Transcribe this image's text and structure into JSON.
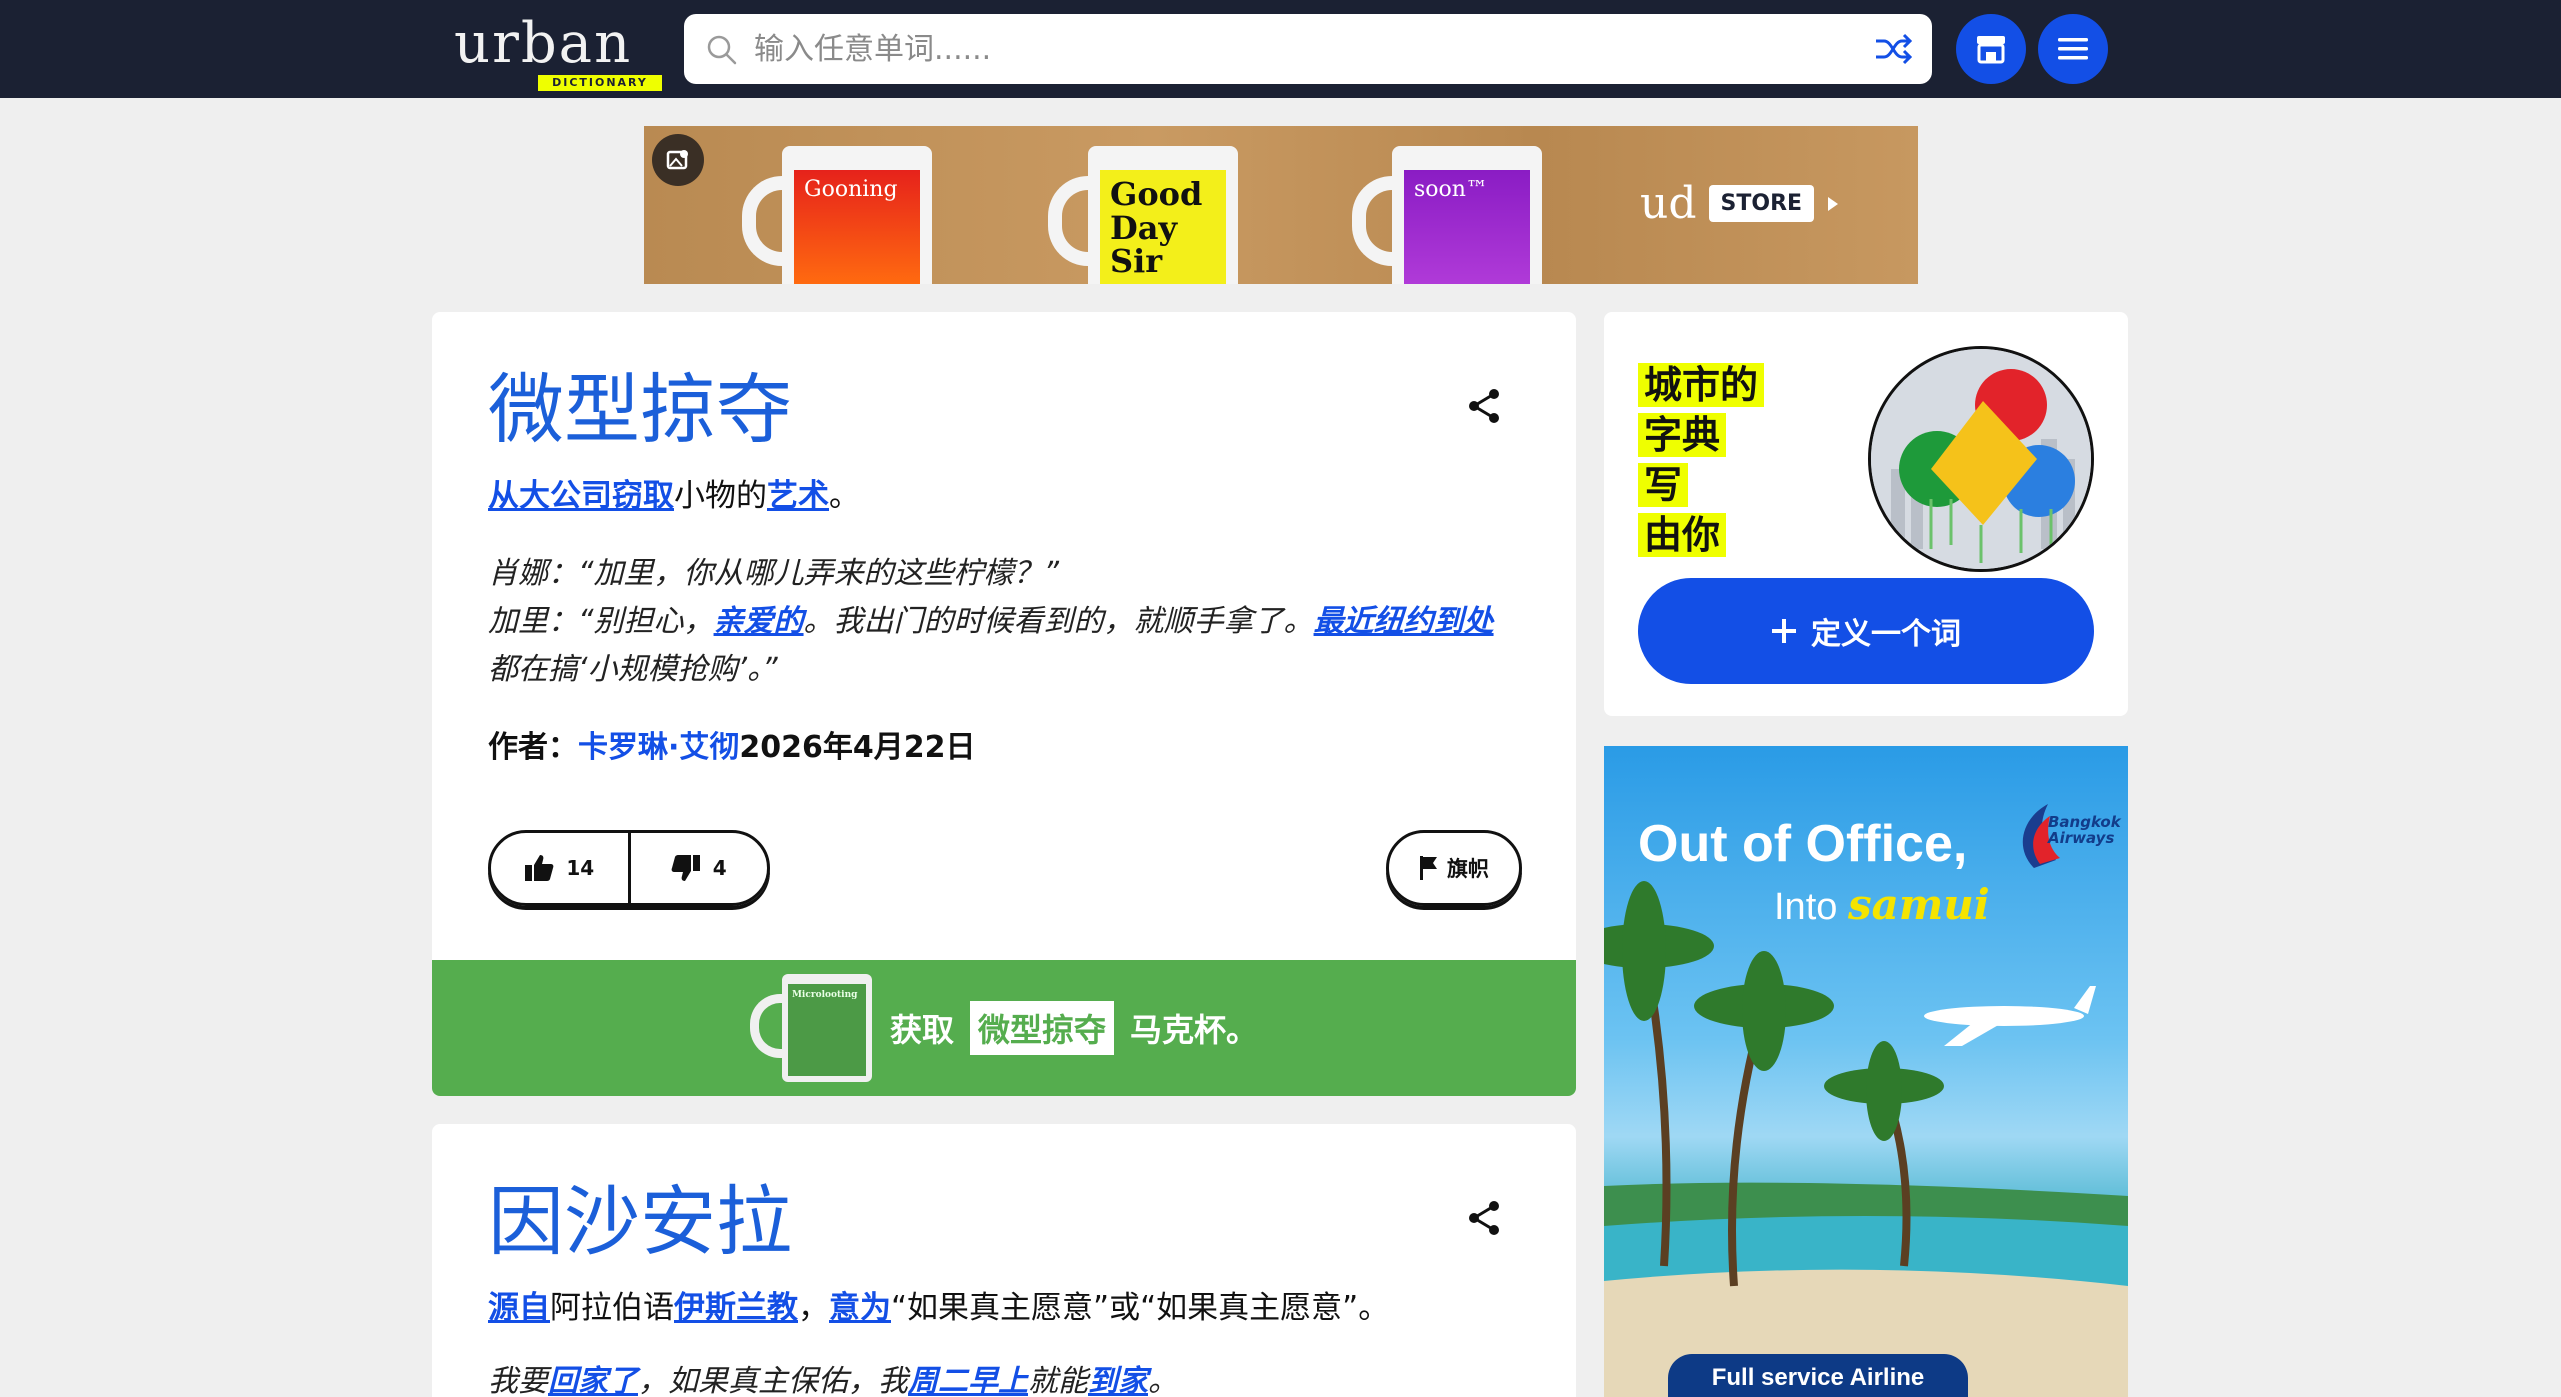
{
  "header": {
    "logo_word": "urban",
    "logo_tag": "DICTIONARY",
    "search_placeholder": "输入任意单词......"
  },
  "banner": {
    "mugs": [
      "Gooning",
      "Good Day Sir",
      "soon™"
    ],
    "brand": "ud",
    "store_label": "STORE"
  },
  "entries": [
    {
      "word": "微型掠夺",
      "meaning_parts": {
        "link1": "从大公司窃取",
        "text1": "小物的",
        "link2": "艺术",
        "text2": "。"
      },
      "example_parts": {
        "line1": "肖娜：“加里，你从哪儿弄来的这些柠檬？”",
        "line2a": "加里：“别担心，",
        "link1": "亲爱的",
        "line2b": "。我出门的时候看到的，就顺手拿了。",
        "link2": "最近纽约到处",
        "line2c": " 都在搞‘小规模抢购’。”"
      },
      "author_label": "作者：",
      "author_name": "卡罗琳·艾彻",
      "date": "2026年4月22日",
      "upvotes": "14",
      "downvotes": "4",
      "flag_label": "旗帜",
      "mug_cta": {
        "prefix": "获取",
        "word": "微型掠夺",
        "suffix": "马克杯。",
        "mug_print": "Microlooting"
      }
    },
    {
      "word": "因沙安拉",
      "meaning_parts": {
        "link1": "源自",
        "text1": "阿拉伯语",
        "link2": "伊斯兰教",
        "text2": "，",
        "link3": "意为",
        "text3": "“如果真主愿意”或“如果真主愿意”。"
      },
      "example_parts": {
        "a": "我要",
        "link1": "回家了",
        "b": "，如果真主保佑，我",
        "link2": "周二早上",
        "c": "就能",
        "link3": "到家",
        "d": "。"
      }
    }
  ],
  "sidebar": {
    "slogan_lines": [
      "城市的",
      "字典",
      "写",
      "由你"
    ],
    "define_label": "定义一个词"
  },
  "side_ad": {
    "headline": "Out of Office,",
    "sub_into": "Into",
    "sub_place": "samui",
    "brand": "Bangkok Airways",
    "airline_label": "Full service Airline"
  },
  "colors": {
    "header_bg": "#1b2133",
    "accent_blue": "#134fe6",
    "title_blue": "#1b5fd9",
    "mug_strip_green": "#55ad4e",
    "highlight_yellow": "#efff00"
  }
}
